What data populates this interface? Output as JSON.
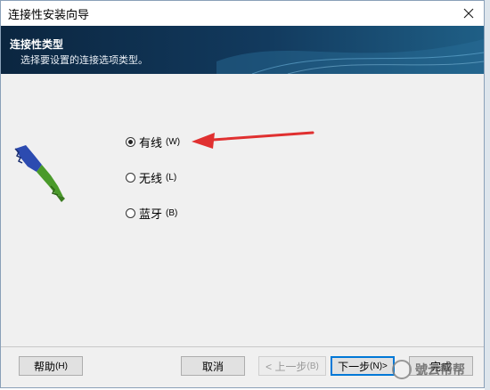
{
  "window": {
    "title": "连接性安装向导"
  },
  "banner": {
    "title": "连接性类型",
    "subtitle": "选择要设置的连接选项类型。"
  },
  "options": [
    {
      "label": "有线",
      "hotkey": "(W)",
      "checked": true
    },
    {
      "label": "无线",
      "hotkey": "(L)",
      "checked": false
    },
    {
      "label": "蓝牙",
      "hotkey": "(B)",
      "checked": false
    }
  ],
  "buttons": {
    "help": {
      "label": "帮助",
      "hotkey": "(H)"
    },
    "cancel": {
      "label": "取消"
    },
    "back": {
      "label": "< 上一步",
      "hotkey": "(B)"
    },
    "next": {
      "label": "下一步",
      "hotkey": "(N)>"
    },
    "finish": {
      "label": "完成"
    }
  },
  "watermark": {
    "text": "號云帮帮"
  },
  "colors": {
    "arrow": "#e03030",
    "banner": "#123a5e",
    "accent": "#0078d7"
  }
}
